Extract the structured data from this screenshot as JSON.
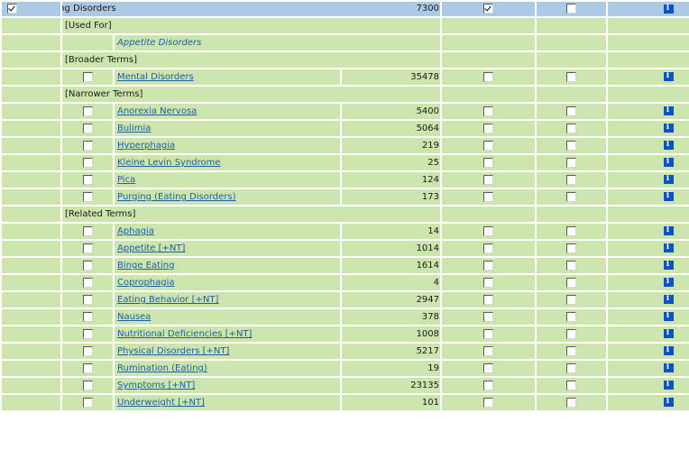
{
  "main_term": {
    "label": "Eating Disorders",
    "count": "7300",
    "selected": true,
    "explode": true,
    "focus": false
  },
  "sections": {
    "used_for": {
      "heading": "[Used For]",
      "items": [
        "Appetite Disorders"
      ]
    },
    "broader": {
      "heading": "[Broader Terms]",
      "items": [
        {
          "label": "Mental Disorders",
          "count": "35478"
        }
      ]
    },
    "narrower": {
      "heading": "[Narrower Terms]",
      "items": [
        {
          "label": "Anorexia Nervosa",
          "count": "5400"
        },
        {
          "label": "Bulimia",
          "count": "5064"
        },
        {
          "label": "Hyperphagia",
          "count": "219"
        },
        {
          "label": "Kleine Levin Syndrome",
          "count": "25"
        },
        {
          "label": "Pica",
          "count": "124"
        },
        {
          "label": "Purging (Eating Disorders)",
          "count": "173"
        }
      ]
    },
    "related": {
      "heading": "[Related Terms]",
      "items": [
        {
          "label": "Aphagia",
          "count": "14"
        },
        {
          "label": "Appetite [+NT]",
          "count": "1014"
        },
        {
          "label": "Binge Eating",
          "count": "1614"
        },
        {
          "label": "Coprophagia",
          "count": "4"
        },
        {
          "label": "Eating Behavior [+NT]",
          "count": "2947"
        },
        {
          "label": "Nausea",
          "count": "378"
        },
        {
          "label": "Nutritional Deficiencies [+NT]",
          "count": "1008"
        },
        {
          "label": "Physical Disorders [+NT]",
          "count": "5217"
        },
        {
          "label": "Rumination (Eating)",
          "count": "19"
        },
        {
          "label": "Symptoms [+NT]",
          "count": "23135"
        },
        {
          "label": "Underweight [+NT]",
          "count": "101"
        }
      ]
    }
  },
  "icons": {
    "info": "i"
  }
}
